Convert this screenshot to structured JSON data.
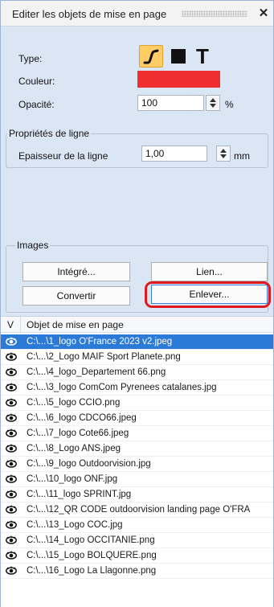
{
  "window": {
    "title": "Editer les objets de mise en page",
    "close_icon": "close-icon"
  },
  "type": {
    "label": "Type:",
    "tools": [
      "line-tool-icon",
      "rectangle-tool-icon",
      "text-tool-icon"
    ],
    "selected_tool": "line"
  },
  "color": {
    "label": "Couleur:",
    "value": "#ef2f2f"
  },
  "opacity": {
    "label": "Opacité:",
    "value": "100",
    "unit": "%"
  },
  "line_props": {
    "group_title": "Propriétés de ligne",
    "thickness_label": "Epaisseur de la ligne",
    "thickness_value": "1,00",
    "unit": "mm"
  },
  "images": {
    "group_title": "Images",
    "buttons": {
      "integrated": "Intégré...",
      "link": "Lien...",
      "convert": "Convertir",
      "remove": "Enlever..."
    }
  },
  "list": {
    "columns": {
      "v": "V",
      "name": "Objet de mise en page"
    },
    "rows": [
      "C:\\...\\1_logo O'France 2023 v2.jpeg",
      "C:\\...\\2_Logo MAIF Sport Planete.png",
      "C:\\...\\4_logo_Departement 66.png",
      "C:\\...\\3_logo ComCom Pyrenees catalanes.jpg",
      "C:\\...\\5_logo CCIO.png",
      "C:\\...\\6_logo CDCO66.jpeg",
      "C:\\...\\7_logo Cote66.jpeg",
      "C:\\...\\8_Logo ANS.jpeg",
      "C:\\...\\9_logo Outdoorvision.jpg",
      "C:\\...\\10_logo ONF.jpg",
      "C:\\...\\11_logo SPRINT.jpg",
      "C:\\...\\12_QR CODE outdoorvision landing page O'FRA",
      "C:\\...\\13_Logo COC.jpg",
      "C:\\...\\14_Logo OCCITANIE.png",
      "C:\\...\\15_Logo BOLQUERE.png",
      "C:\\...\\16_Logo La Llagonne.png"
    ],
    "selected_index": 0,
    "row_icon": "eye-icon"
  },
  "colors": {
    "accent": "#2b7ad8",
    "panel": "#dbe6f4",
    "highlight": "#e0191f",
    "active_tool": "#ffcc66"
  }
}
